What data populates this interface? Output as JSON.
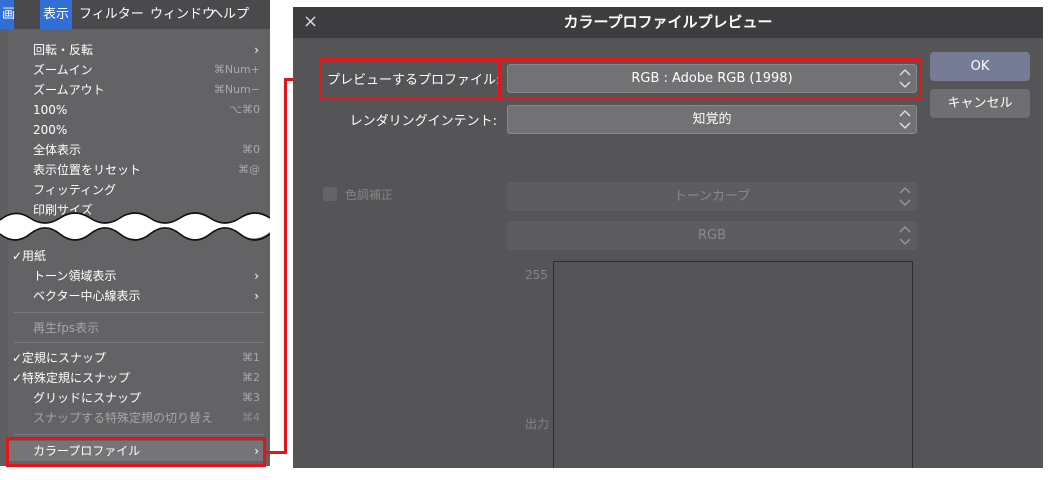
{
  "menubar": {
    "first": "画",
    "items": [
      "表示",
      "フィルター",
      "ウィンドウ",
      "ヘルプ"
    ]
  },
  "menu": {
    "items": [
      {
        "label": "回転・反転",
        "shortcut": "",
        "arrow": true
      },
      {
        "label": "ズームイン",
        "shortcut": "⌘Num+",
        "arrow": false
      },
      {
        "label": "ズームアウト",
        "shortcut": "⌘Num−",
        "arrow": false
      },
      {
        "label": "100%",
        "shortcut": "⌥⌘0",
        "arrow": false
      },
      {
        "label": "200%",
        "shortcut": "",
        "arrow": false
      },
      {
        "label": "全体表示",
        "shortcut": "⌘0",
        "arrow": false
      },
      {
        "label": "表示位置をリセット",
        "shortcut": "⌘@",
        "arrow": false
      },
      {
        "label": "フィッティング",
        "shortcut": "",
        "arrow": false
      },
      {
        "label": "印刷サイズ",
        "shortcut": "",
        "arrow": false
      },
      {
        "label": "用紙",
        "shortcut": "",
        "arrow": false,
        "checked": true
      },
      {
        "label": "トーン領域表示",
        "shortcut": "",
        "arrow": true
      },
      {
        "label": "ベクター中心線表示",
        "shortcut": "",
        "arrow": true
      },
      {
        "label": "再生fps表示",
        "shortcut": "",
        "arrow": false,
        "disabled": true
      },
      {
        "label": "定規にスナップ",
        "shortcut": "⌘1",
        "arrow": false,
        "checked": true
      },
      {
        "label": "特殊定規にスナップ",
        "shortcut": "⌘2",
        "arrow": false,
        "checked": true
      },
      {
        "label": "グリッドにスナップ",
        "shortcut": "⌘3",
        "arrow": false
      },
      {
        "label": "スナップする特殊定規の切り替え",
        "shortcut": "⌘4",
        "arrow": false,
        "disabled": true
      },
      {
        "label": "カラープロファイル",
        "shortcut": "",
        "arrow": true
      }
    ],
    "check_mark": "✓",
    "arrow_glyph": "›"
  },
  "dialog": {
    "title": "カラープロファイルプレビュー",
    "close": "×",
    "profile_label": "プレビューするプロファイル:",
    "profile_value": "RGB : Adobe RGB (1998)",
    "intent_label": "レンダリングインテント:",
    "intent_value": "知覚的",
    "ok": "OK",
    "cancel": "キャンセル",
    "tone_label": "色調補正",
    "tone_curve": "トーンカーブ",
    "channel": "RGB",
    "axis_max": "255",
    "axis_output": "出力"
  },
  "colors": {
    "highlight": "#e3151b",
    "menu_accent": "#2f6fd6"
  }
}
